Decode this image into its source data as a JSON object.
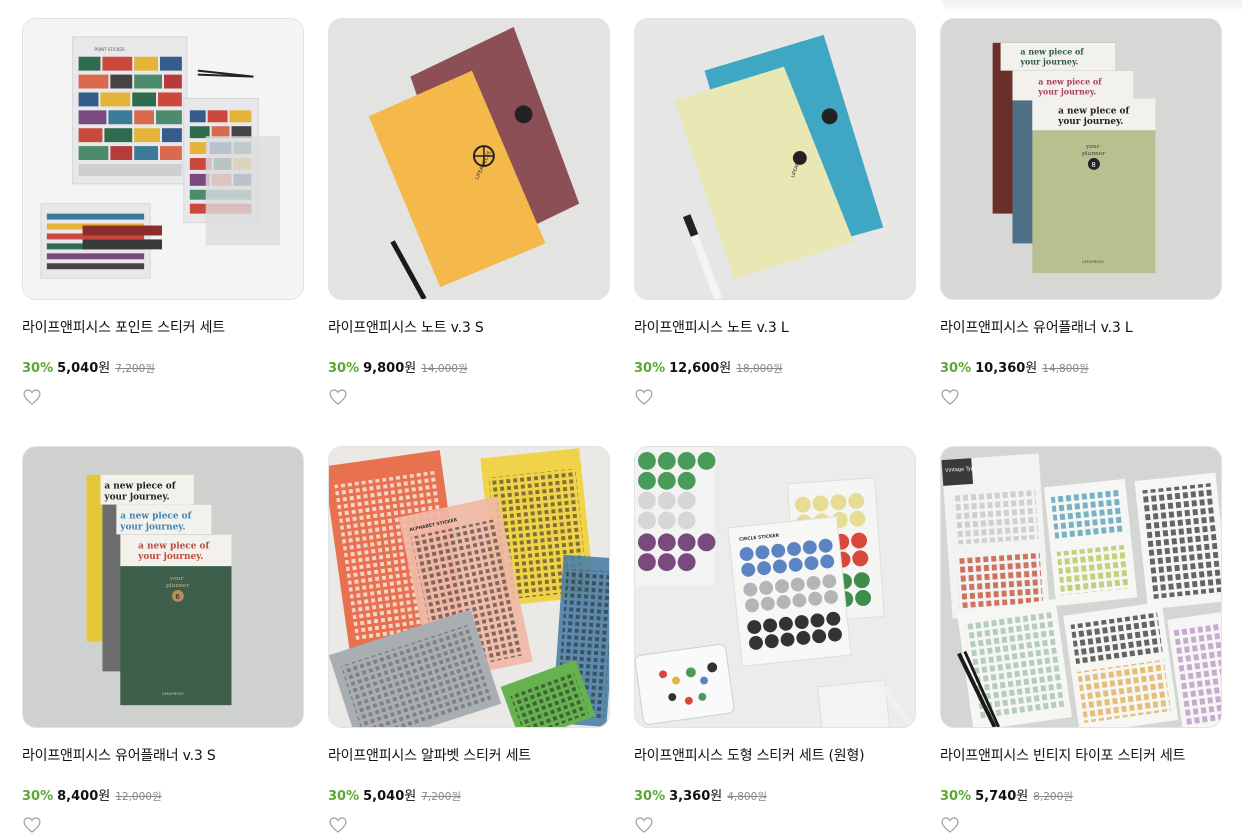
{
  "products": [
    {
      "title": "라이프앤피시스 포인트 스티커 세트",
      "discount": "30%",
      "sale_price": "5,040",
      "currency": "원",
      "original_price": "7,200원"
    },
    {
      "title": "라이프앤피시스 노트 v.3 S",
      "discount": "30%",
      "sale_price": "9,800",
      "currency": "원",
      "original_price": "14,000원"
    },
    {
      "title": "라이프앤피시스 노트 v.3 L",
      "discount": "30%",
      "sale_price": "12,600",
      "currency": "원",
      "original_price": "18,000원"
    },
    {
      "title": "라이프앤피시스 유어플래너 v.3 L",
      "discount": "30%",
      "sale_price": "10,360",
      "currency": "원",
      "original_price": "14,800원"
    },
    {
      "title": "라이프앤피시스 유어플래너 v.3 S",
      "discount": "30%",
      "sale_price": "8,400",
      "currency": "원",
      "original_price": "12,000원"
    },
    {
      "title": "라이프앤피시스 알파벳 스티커 세트",
      "discount": "30%",
      "sale_price": "5,040",
      "currency": "원",
      "original_price": "7,200원"
    },
    {
      "title": "라이프앤피시스 도형 스티커 세트 (원형)",
      "discount": "30%",
      "sale_price": "3,360",
      "currency": "원",
      "original_price": "4,800원"
    },
    {
      "title": "라이프앤피시스 빈티지 타이포 스티커 세트",
      "discount": "30%",
      "sale_price": "5,740",
      "currency": "원",
      "original_price": "8,200원"
    }
  ],
  "image_text": {
    "brand": "LIFEAPIECES",
    "journey_line1": "a new piece of",
    "journey_line2": "your journey.",
    "planner_line1": "your",
    "planner_line2": "planner",
    "planner_number_l": "8",
    "planner_number_s": "6",
    "alphabet_sticker": "ALPHABET STICKER",
    "circle_sticker": "CIRCLE STICKER",
    "point_sticker": "POINT STICKER",
    "vintage_typo": "Vintage Typo"
  },
  "colors": {
    "discount_green": "#5aa832",
    "notebook_yellow": "#f4b94a",
    "notebook_maroon": "#8c4f56",
    "notebook_pale": "#e9e7b3",
    "notebook_blue": "#3fa6c4",
    "planner_olive": "#b9c08f",
    "planner_green": "#3d5e4a"
  }
}
